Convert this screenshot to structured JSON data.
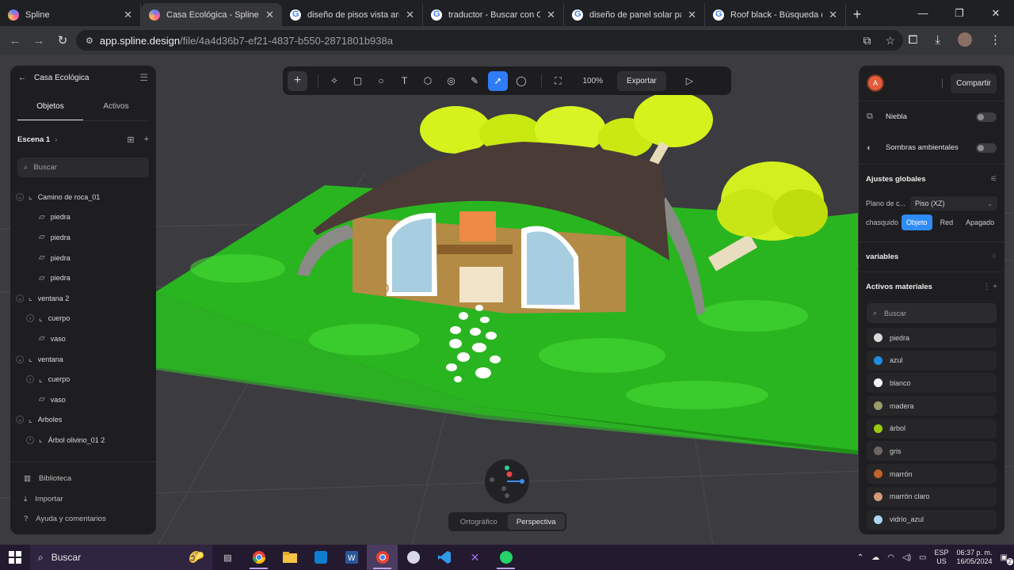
{
  "browser": {
    "tabs": [
      {
        "label": "Spline",
        "icon": "spline-icon",
        "active": false
      },
      {
        "label": "Casa Ecológica - Spline",
        "icon": "spline-icon",
        "active": true
      },
      {
        "label": "diseño de pisos vista arriba -",
        "icon": "google-icon",
        "active": false
      },
      {
        "label": "traductor - Buscar con Goog",
        "icon": "google-icon",
        "active": false
      },
      {
        "label": "diseño de panel solar parea",
        "icon": "google-icon",
        "active": false
      },
      {
        "label": "Roof black - Búsqueda de G",
        "icon": "google-icon",
        "active": false
      }
    ],
    "url_host": "app.spline.design",
    "url_path": "/file/4a4d36b7-ef21-4837-b550-2871801b938a"
  },
  "left_panel": {
    "title": "Casa Ecológica",
    "tabs": [
      "Objetos",
      "Activos"
    ],
    "scene_label": "Escena 1",
    "search_placeholder": "Buscar",
    "tree": [
      {
        "label": "Camino de roca_01",
        "level": 0,
        "type": "group",
        "expanded": true
      },
      {
        "label": "piedra",
        "level": 1,
        "type": "shape"
      },
      {
        "label": "piedra",
        "level": 1,
        "type": "shape"
      },
      {
        "label": "piedra",
        "level": 1,
        "type": "shape"
      },
      {
        "label": "piedra",
        "level": 1,
        "type": "shape"
      },
      {
        "label": "ventana 2",
        "level": 0,
        "type": "group",
        "expanded": true
      },
      {
        "label": "cuerpo",
        "level": 1,
        "type": "group-collapsed"
      },
      {
        "label": "vaso",
        "level": 1,
        "type": "shape"
      },
      {
        "label": "ventana",
        "level": 0,
        "type": "group",
        "expanded": true
      },
      {
        "label": "cuerpo",
        "level": 1,
        "type": "group-collapsed"
      },
      {
        "label": "vaso",
        "level": 1,
        "type": "shape"
      },
      {
        "label": "Arboles",
        "level": 0,
        "type": "group",
        "expanded": true
      },
      {
        "label": "Árbol olivino_01 2",
        "level": 1,
        "type": "group-collapsed"
      }
    ],
    "footer": [
      {
        "label": "Biblioteca",
        "icon": "library-icon"
      },
      {
        "label": "Importar",
        "icon": "import-icon"
      },
      {
        "label": "Ayuda y comentarios",
        "icon": "help-icon"
      }
    ]
  },
  "toolbar": {
    "zoom": "100%",
    "export_label": "Exportar"
  },
  "right_panel": {
    "avatar_letter": "A",
    "share_label": "Compartir",
    "fog_label": "Niebla",
    "ambient_shadows_label": "Sombras ambientales",
    "global_settings_label": "Ajustes globales",
    "plane_label": "Plano de c...",
    "plane_value": "Piso (XZ)",
    "snap_label": "chasquido",
    "snap_options": [
      "Objeto",
      "Red",
      "Apagado"
    ],
    "snap_selected": "Objeto",
    "variables_label": "variables",
    "materials_label": "Activos materiales",
    "materials_search_placeholder": "Buscar",
    "materials": [
      {
        "name": "piedra",
        "color": "#d9d9d9"
      },
      {
        "name": "azul",
        "color": "#1f8ce0"
      },
      {
        "name": "blanco",
        "color": "#f4f4f4"
      },
      {
        "name": "madera",
        "color": "#9a9a6c"
      },
      {
        "name": "árbol",
        "color": "#9acb10"
      },
      {
        "name": "gris",
        "color": "#6f6464"
      },
      {
        "name": "marrón",
        "color": "#c0622a"
      },
      {
        "name": "marrón claro",
        "color": "#d39a7a"
      },
      {
        "name": "vidrio_azul",
        "color": "#a9d7f5"
      }
    ]
  },
  "view_modes": [
    "Ortográfico",
    "Perspectiva"
  ],
  "view_mode_selected": "Perspectiva",
  "taskbar": {
    "search_placeholder": "Buscar",
    "lang_line1": "ESP",
    "lang_line2": "US",
    "time": "06:37 p. m.",
    "date": "16/05/2024",
    "notification_count": "2"
  }
}
